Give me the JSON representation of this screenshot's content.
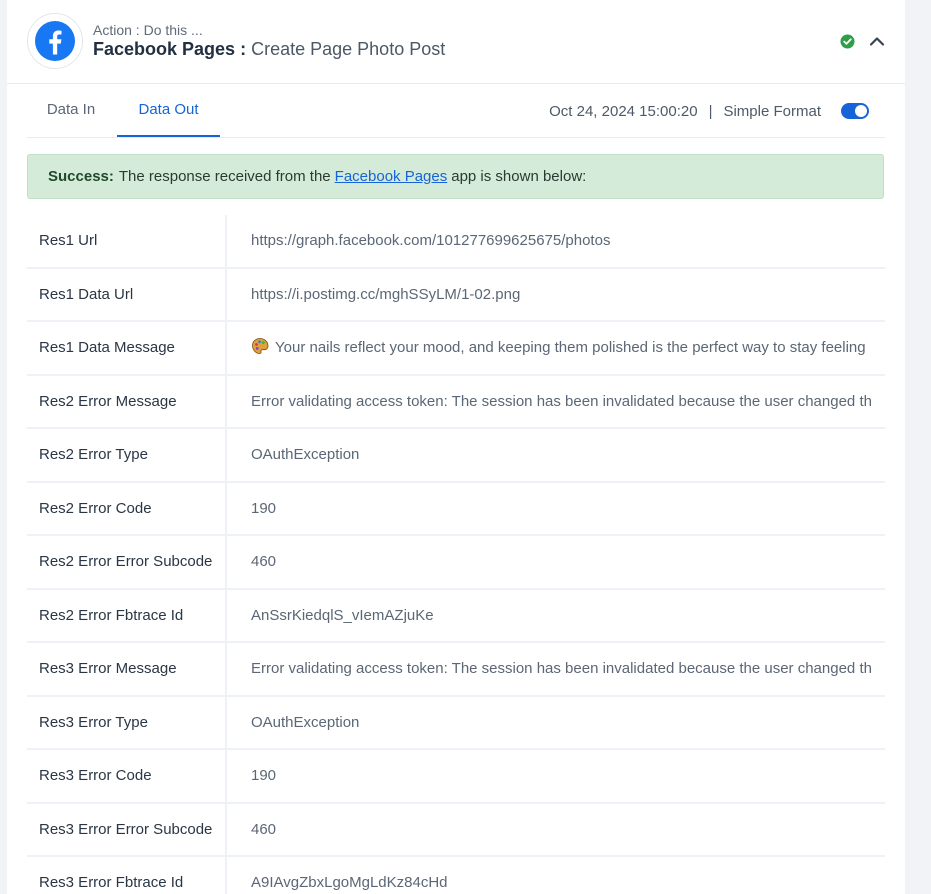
{
  "header": {
    "subtitle": "Action : Do this ...",
    "app_name": "Facebook Pages",
    "separator": ":",
    "action_name": "Create Page Photo Post",
    "status_icon": "check-circle-icon",
    "collapse_icon": "chevron-up-icon"
  },
  "tabs": [
    {
      "label": "Data In",
      "active": false
    },
    {
      "label": "Data Out",
      "active": true
    }
  ],
  "meta": {
    "timestamp": "Oct 24, 2024 15:00:20",
    "divider": "|",
    "format_label": "Simple Format",
    "format_toggle_on": true
  },
  "alert": {
    "prefix": "Success:",
    "text_before": "The response received from the",
    "link_text": "Facebook Pages",
    "text_after": "app is shown below:"
  },
  "rows": [
    {
      "key": "Res1 Url",
      "value": "https://graph.facebook.com/101277699625675/photos"
    },
    {
      "key": "Res1 Data Url",
      "value": "https://i.postimg.cc/mghSSyLM/1-02.png"
    },
    {
      "key": "Res1 Data Message",
      "value": "Your nails reflect your mood, and keeping them polished is the perfect way to stay feeling",
      "icon": "palette-emoji-icon"
    },
    {
      "key": "Res2 Error Message",
      "value": "Error validating access token: The session has been invalidated because the user changed th"
    },
    {
      "key": "Res2 Error Type",
      "value": "OAuthException"
    },
    {
      "key": "Res2 Error Code",
      "value": "190"
    },
    {
      "key": "Res2 Error Error Subcode",
      "value": "460"
    },
    {
      "key": "Res2 Error Fbtrace Id",
      "value": "AnSsrKiedqlS_vIemAZjuKe"
    },
    {
      "key": "Res3 Error Message",
      "value": "Error validating access token: The session has been invalidated because the user changed th"
    },
    {
      "key": "Res3 Error Type",
      "value": "OAuthException"
    },
    {
      "key": "Res3 Error Code",
      "value": "190"
    },
    {
      "key": "Res3 Error Error Subcode",
      "value": "460"
    },
    {
      "key": "Res3 Error Fbtrace Id",
      "value": "A9IAvgZbxLgoMgLdKz84cHd"
    }
  ],
  "colors": {
    "accent": "#1565d8",
    "success_bg": "#d5ebd9",
    "success_icon": "#2e9e47",
    "facebook_blue": "#1877f2"
  }
}
